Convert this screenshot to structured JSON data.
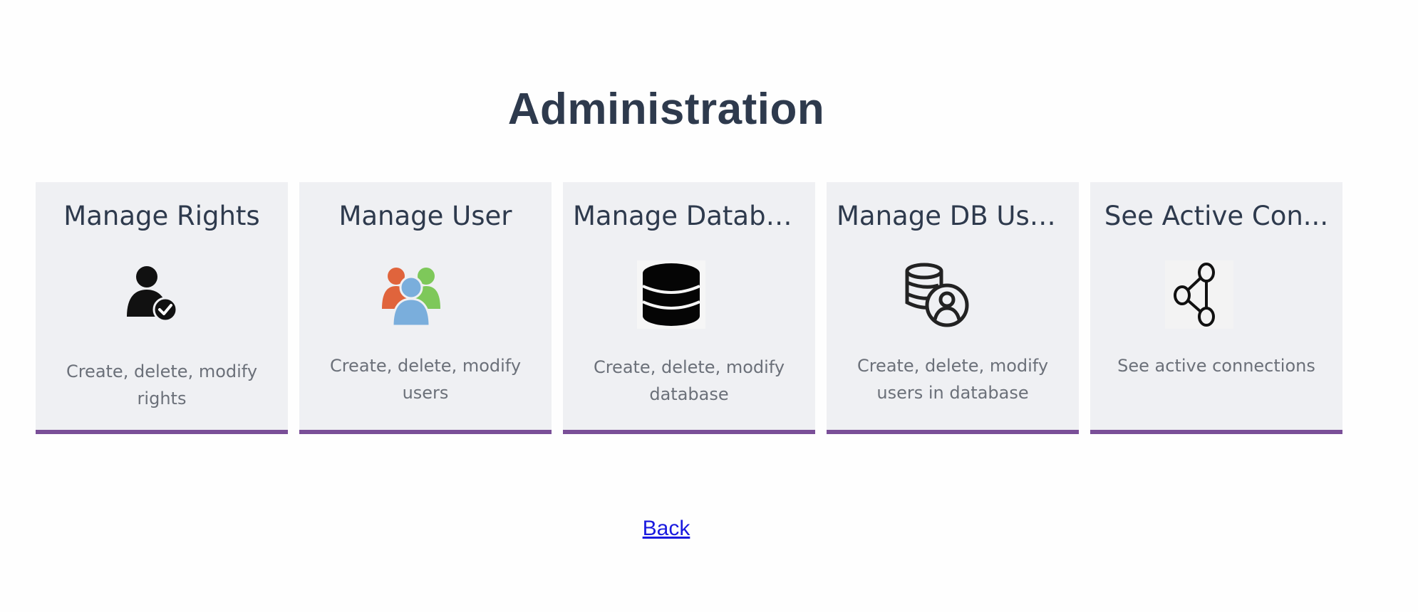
{
  "page": {
    "title": "Administration",
    "back_label": "Back"
  },
  "colors": {
    "card_background": "#eff0f3",
    "card_accent": "#7a4f98",
    "title_text": "#2e3a4d",
    "description_text": "#6b7079",
    "link": "#1a1adf"
  },
  "cards": [
    {
      "title": "Manage Rights",
      "icon": "user-check-icon",
      "description": "Create, delete, modify rights"
    },
    {
      "title": "Manage User",
      "icon": "users-group-icon",
      "description": "Create, delete, modify users"
    },
    {
      "title": "Manage Database",
      "icon": "database-icon",
      "description": "Create, delete, modify database"
    },
    {
      "title": "Manage DB Users",
      "icon": "database-user-icon",
      "description": "Create, delete, modify users in database"
    },
    {
      "title": "See Active Con...",
      "icon": "share-nodes-icon",
      "description": "See active connections"
    }
  ]
}
